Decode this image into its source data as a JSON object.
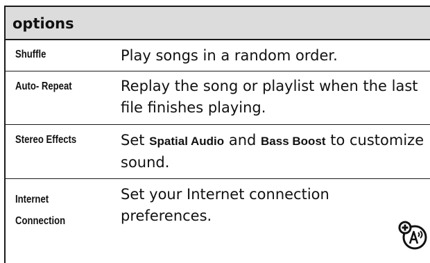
{
  "header": {
    "title": "options"
  },
  "rows": [
    {
      "name": "Shuffle",
      "desc": "Play songs in a random order."
    },
    {
      "name": "Auto- Repeat",
      "desc_line1": "Replay the song or playlist when the last",
      "desc_line2": "file finishes playing."
    },
    {
      "name": "Stereo Effects",
      "desc_prefix": "Set ",
      "desc_bold1": "Spatial Audio",
      "desc_mid": " and ",
      "desc_bold2": "Bass Boost",
      "desc_suffix": " to customize",
      "desc_line2": "sound."
    },
    {
      "name_line1": "Internet",
      "name_line2": "Connection",
      "desc_line1": "Set your Internet connection",
      "desc_line2": "preferences."
    }
  ],
  "icons": {
    "network_feature": "network-dependent-feature-icon"
  }
}
